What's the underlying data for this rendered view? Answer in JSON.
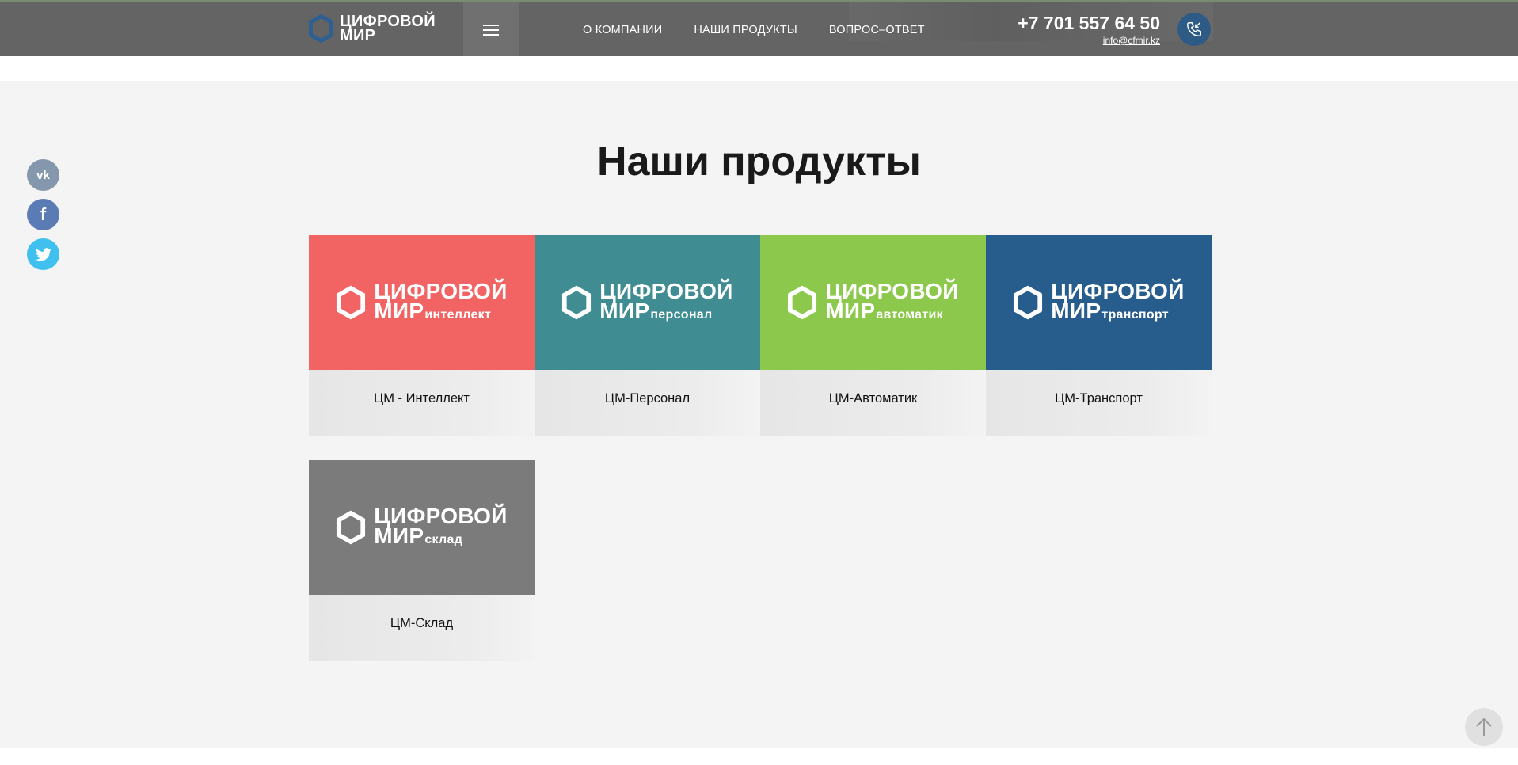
{
  "header": {
    "logo_line1": "ЦИФРОВОЙ",
    "logo_line2": "МИР",
    "nav": [
      "О КОМПАНИИ",
      "НАШИ ПРОДУКТЫ",
      "ВОПРОС–ОТВЕТ"
    ],
    "phone": "+7 701 557 64 50",
    "email": "info@cfmir.kz"
  },
  "social": {
    "vk": "vk",
    "facebook": "f",
    "twitter": "twitter-icon"
  },
  "products": {
    "title": "Наши продукты",
    "items": [
      {
        "brand_line1": "ЦИФРОВОЙ",
        "brand_line2": "МИР",
        "brand_sub": "интеллект",
        "name": "ЦМ - Интеллект",
        "color": "#f26464"
      },
      {
        "brand_line1": "ЦИФРОВОЙ",
        "brand_line2": "МИР",
        "brand_sub": "персонал",
        "name": "ЦМ-Персонал",
        "color": "#3f8c92"
      },
      {
        "brand_line1": "ЦИФРОВОЙ",
        "brand_line2": "МИР",
        "brand_sub": "автоматик",
        "name": "ЦМ-Автоматик",
        "color": "#8bc84b"
      },
      {
        "brand_line1": "ЦИФРОВОЙ",
        "brand_line2": "МИР",
        "brand_sub": "транспорт",
        "name": "ЦМ-Транспорт",
        "color": "#275d8c"
      },
      {
        "brand_line1": "ЦИФРОВОЙ",
        "brand_line2": "МИР",
        "brand_sub": "склад",
        "name": "ЦМ-Склад",
        "color": "#7b7b7c"
      }
    ]
  },
  "colors": {
    "header_bg": "#646464",
    "section_bg": "#f4f4f4",
    "vk": "#8597ad",
    "facebook": "#5b7bb4",
    "twitter": "#3fc0ee",
    "logo_hex": "#2d5f93"
  }
}
